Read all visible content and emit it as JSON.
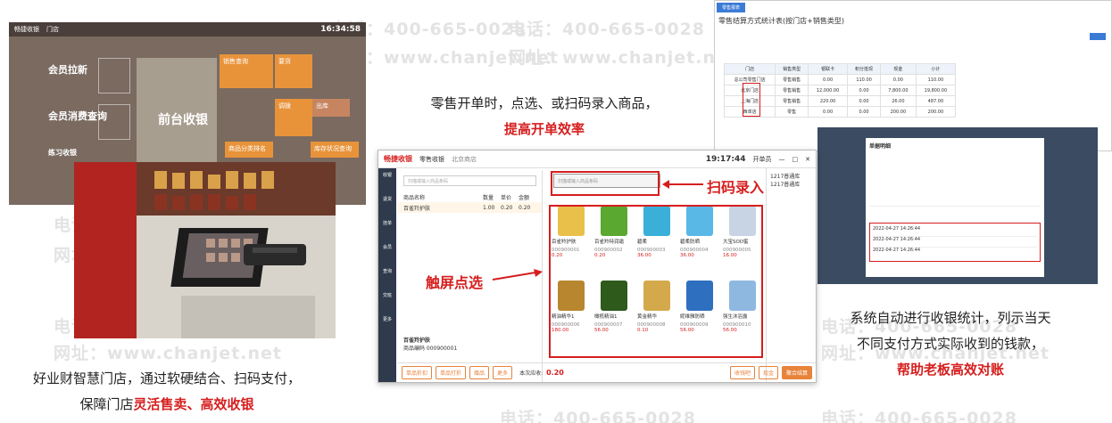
{
  "watermark": {
    "phone": "电话：400-665-0028",
    "site": "网址：www.chanjet.net"
  },
  "captions": {
    "pos_top_line": "零售开单时，点选、或扫码录入商品，",
    "pos_top_highlight": "提高开单效率",
    "left_line1": "好业财智慧门店，通过软硬结合、扫码支付，",
    "left_line2_prefix": "保障门店",
    "left_line2_highlight": "灵活售卖、高效收银",
    "right_line1": "系统自动进行收银统计，列示当天",
    "right_line2": "不同支付方式实际收到的钱款，",
    "right_highlight": "帮助老板高效对账"
  },
  "labels": {
    "scan_input": "扫码录入",
    "touch_select": "触屏点选"
  },
  "home": {
    "app_name": "畅捷收银",
    "store": "门店",
    "clock": "16:34:58",
    "tiles": {
      "member_pull": "会员拉新",
      "member_spend": "会员消费查询",
      "practice": "练习收银",
      "front_cashier": "前台收银",
      "sales_query": "销售查询",
      "requisition": "要货",
      "transfer": "调拨",
      "outbound": "出库",
      "product_rank": "商品分类排名",
      "inventory_query": "库存状况查询"
    }
  },
  "pos": {
    "app_name": "畅捷收银",
    "module": "零售收银",
    "store": "北京商店",
    "clock": "19:17:44",
    "user": "开单员",
    "scan_placeholder": "扫描或输入商品条码",
    "cart_headers": [
      "商品名称",
      "数量",
      "单价",
      "金额"
    ],
    "cart_rows": [
      {
        "name": "百雀羚护肤",
        "qty": "1.00",
        "price": "0.20",
        "amount": "0.20"
      }
    ],
    "selected_title": "百雀羚护肤",
    "selected_code": "商品编码 000900001",
    "side_nav": [
      "收银",
      "退货",
      "挂单",
      "会员",
      "查询",
      "交班",
      "更多"
    ],
    "items": [
      {
        "name": "百雀羚护肤",
        "code": "000900001",
        "price": "0.20",
        "color": "#e8c04a"
      },
      {
        "name": "百雀羚特润霜",
        "code": "000900002",
        "price": "0.20",
        "color": "#5aa830"
      },
      {
        "name": "碧柔",
        "code": "000900003",
        "price": "36.00",
        "color": "#3ab0d8"
      },
      {
        "name": "碧柔防晒",
        "code": "000900004",
        "price": "36.00",
        "color": "#5ab8e6"
      },
      {
        "name": "大宝SOD蜜",
        "code": "000900005",
        "price": "16.00",
        "color": "#c8d4e4"
      },
      {
        "name": "精油精华1",
        "code": "000900006",
        "price": "180.00",
        "color": "#b8862f"
      },
      {
        "name": "橄榄精油1",
        "code": "000900007",
        "price": "56.00",
        "color": "#2e5a1c"
      },
      {
        "name": "黄金精华",
        "code": "000900008",
        "price": "0.10",
        "color": "#d4a94c"
      },
      {
        "name": "妮维雅防晒",
        "code": "000900009",
        "price": "56.00",
        "color": "#2f6fbf"
      },
      {
        "name": "强生沐浴露",
        "code": "000900010",
        "price": "56.00",
        "color": "#8fb8e0"
      }
    ],
    "right_col": [
      "1217普通库",
      "1217普通库"
    ],
    "buttons": [
      "单品折扣",
      "单品打折",
      "赠品",
      "更多"
    ],
    "total_label": "本次应收:",
    "total_value": "0.20",
    "pay_buttons": [
      "收钱吧",
      "现金",
      "聚合结算"
    ]
  },
  "report": {
    "tab": "零售报表",
    "title": "零售结算方式统计表(按门店+销售类型)",
    "headers": [
      "门店",
      "销售类型",
      "银联卡",
      "积分抵现",
      "现金",
      "小计"
    ],
    "rows": [
      [
        "总公司零售门店",
        "零售销售",
        "0.00",
        "110.00",
        "0.00",
        "110.00"
      ],
      [
        "北京门店",
        "零售销售",
        "12,000.00",
        "0.00",
        "7,800.00",
        "19,800.00"
      ],
      [
        "上海门店",
        "零售销售",
        "220.00",
        "0.00",
        "26.00",
        "487.00"
      ],
      [
        "西单店",
        "零售",
        "0.00",
        "0.00",
        "200.00",
        "200.00"
      ]
    ]
  },
  "detail": {
    "title": "单据明细",
    "rows": [
      "2022-04-27 14:26:44",
      "2022-04-27 14:26:44",
      "2022-04-27 14:26:44"
    ]
  }
}
